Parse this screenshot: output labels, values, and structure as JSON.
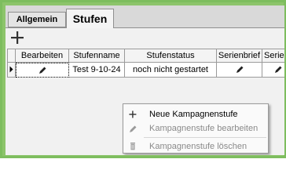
{
  "tabs": [
    {
      "label": "Allgemein",
      "active": false
    },
    {
      "label": "Stufen",
      "active": true
    }
  ],
  "toolbar": {
    "add_icon": "plus-icon"
  },
  "grid": {
    "columns": [
      "Bearbeiten",
      "Stufenname",
      "Stufenstatus",
      "Serienbrief",
      "Serien-"
    ],
    "rows": [
      {
        "edit_icon": "pencil-icon",
        "name": "Test 9-10-24",
        "status": "noch nicht gestartet",
        "letter_icon": "pencil-icon",
        "series_icon": "pencil-icon"
      }
    ]
  },
  "context_menu": {
    "items": [
      {
        "label": "Neue Kampagnenstufe",
        "icon": "plus-icon",
        "enabled": true
      },
      {
        "label": "Kampagnenstufe bearbeiten",
        "icon": "pencil-icon",
        "enabled": false
      },
      {
        "label": "Kampagnenstufe löschen",
        "icon": "trash-icon",
        "enabled": false
      }
    ]
  },
  "colors": {
    "frame_border": "#7dbd5e",
    "panel_background": "#f1f1f1",
    "tab_strip": "#d9d9d9"
  }
}
